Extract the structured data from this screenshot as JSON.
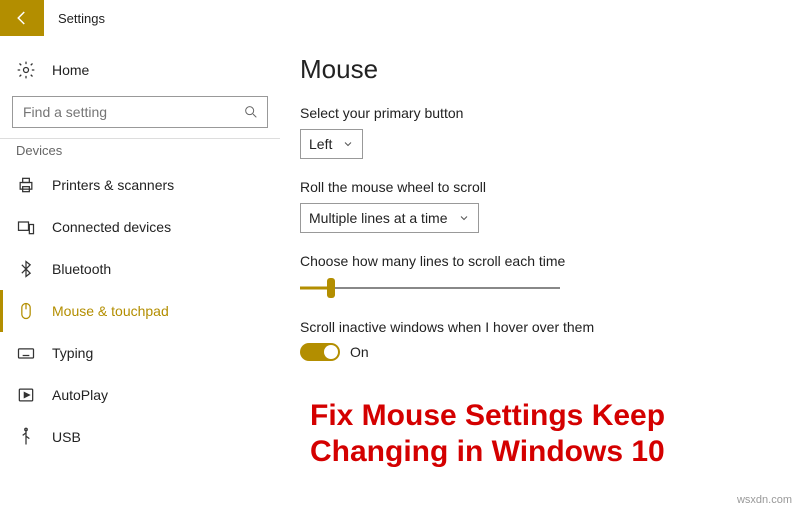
{
  "titlebar": {
    "title": "Settings"
  },
  "sidebar": {
    "home": "Home",
    "search_placeholder": "Find a setting",
    "group": "Devices",
    "items": [
      {
        "label": "Printers & scanners"
      },
      {
        "label": "Connected devices"
      },
      {
        "label": "Bluetooth"
      },
      {
        "label": "Mouse & touchpad"
      },
      {
        "label": "Typing"
      },
      {
        "label": "AutoPlay"
      },
      {
        "label": "USB"
      }
    ]
  },
  "main": {
    "heading": "Mouse",
    "primary_button_label": "Select your primary button",
    "primary_button_value": "Left",
    "wheel_label": "Roll the mouse wheel to scroll",
    "wheel_value": "Multiple lines at a time",
    "lines_label": "Choose how many lines to scroll each time",
    "inactive_label": "Scroll inactive windows when I hover over them",
    "inactive_value": "On"
  },
  "overlay": "Fix Mouse Settings Keep Changing in Windows 10",
  "watermark": "wsxdn.com"
}
